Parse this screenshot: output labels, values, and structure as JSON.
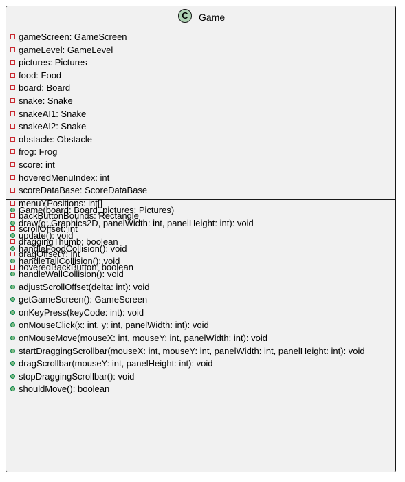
{
  "class": {
    "stereotype_letter": "C",
    "name": "Game",
    "fields": [
      {
        "text": "gameScreen: GameScreen",
        "visibility": "private"
      },
      {
        "text": "gameLevel: GameLevel",
        "visibility": "private"
      },
      {
        "text": "pictures: Pictures",
        "visibility": "private"
      },
      {
        "text": "food: Food",
        "visibility": "private"
      },
      {
        "text": "board: Board",
        "visibility": "private"
      },
      {
        "text": "snake: Snake",
        "visibility": "private"
      },
      {
        "text": "snakeAI1: Snake",
        "visibility": "private"
      },
      {
        "text": "snakeAI2: Snake",
        "visibility": "private"
      },
      {
        "text": "obstacle: Obstacle",
        "visibility": "private"
      },
      {
        "text": "frog: Frog",
        "visibility": "private"
      },
      {
        "text": "score: int",
        "visibility": "private"
      },
      {
        "text": "hoveredMenuIndex: int",
        "visibility": "private"
      },
      {
        "text": "scoreDataBase: ScoreDataBase",
        "visibility": "private"
      },
      {
        "text": "menuYPositions: int[]",
        "visibility": "private"
      },
      {
        "text": "backButtonBounds: Rectangle",
        "visibility": "private"
      },
      {
        "text": "scrollOffset: int",
        "visibility": "private"
      },
      {
        "text": "draggingThumb: boolean",
        "visibility": "private"
      },
      {
        "text": "dragOffsetY: int",
        "visibility": "private"
      },
      {
        "text": "hoveredBackButton: boolean",
        "visibility": "private"
      }
    ],
    "methods": [
      {
        "text": "Game(board: Board, pictures: Pictures)",
        "visibility": "public"
      },
      {
        "text": "draw(g: Graphics2D, panelWidth: int, panelHeight: int): void",
        "visibility": "public"
      },
      {
        "text": "update(): void",
        "visibility": "public"
      },
      {
        "text": "handleFoodCollision(): void",
        "visibility": "public"
      },
      {
        "text": "handleTailCollision(): void",
        "visibility": "public"
      },
      {
        "text": "handleWallCollision(): void",
        "visibility": "public"
      },
      {
        "text": "adjustScrollOffset(delta: int): void",
        "visibility": "public"
      },
      {
        "text": "getGameScreen(): GameScreen",
        "visibility": "public"
      },
      {
        "text": "onKeyPress(keyCode: int): void",
        "visibility": "public"
      },
      {
        "text": "onMouseClick(x: int, y: int, panelWidth: int): void",
        "visibility": "public"
      },
      {
        "text": "onMouseMove(mouseX: int, mouseY: int, panelWidth: int): void",
        "visibility": "public"
      },
      {
        "text": "startDraggingScrollbar(mouseX: int, mouseY: int, panelWidth: int, panelHeight: int): void",
        "visibility": "public"
      },
      {
        "text": "dragScrollbar(mouseY: int, panelHeight: int): void",
        "visibility": "public"
      },
      {
        "text": "stopDraggingScrollbar(): void",
        "visibility": "public"
      },
      {
        "text": "shouldMove(): boolean",
        "visibility": "public"
      }
    ]
  },
  "colors": {
    "class_background": "#f1f1f1",
    "border": "#181818",
    "stereotype_circle": "#add1b2",
    "private_marker": "#c82930",
    "public_marker_fill": "#84be84",
    "public_marker_border": "#038048"
  }
}
